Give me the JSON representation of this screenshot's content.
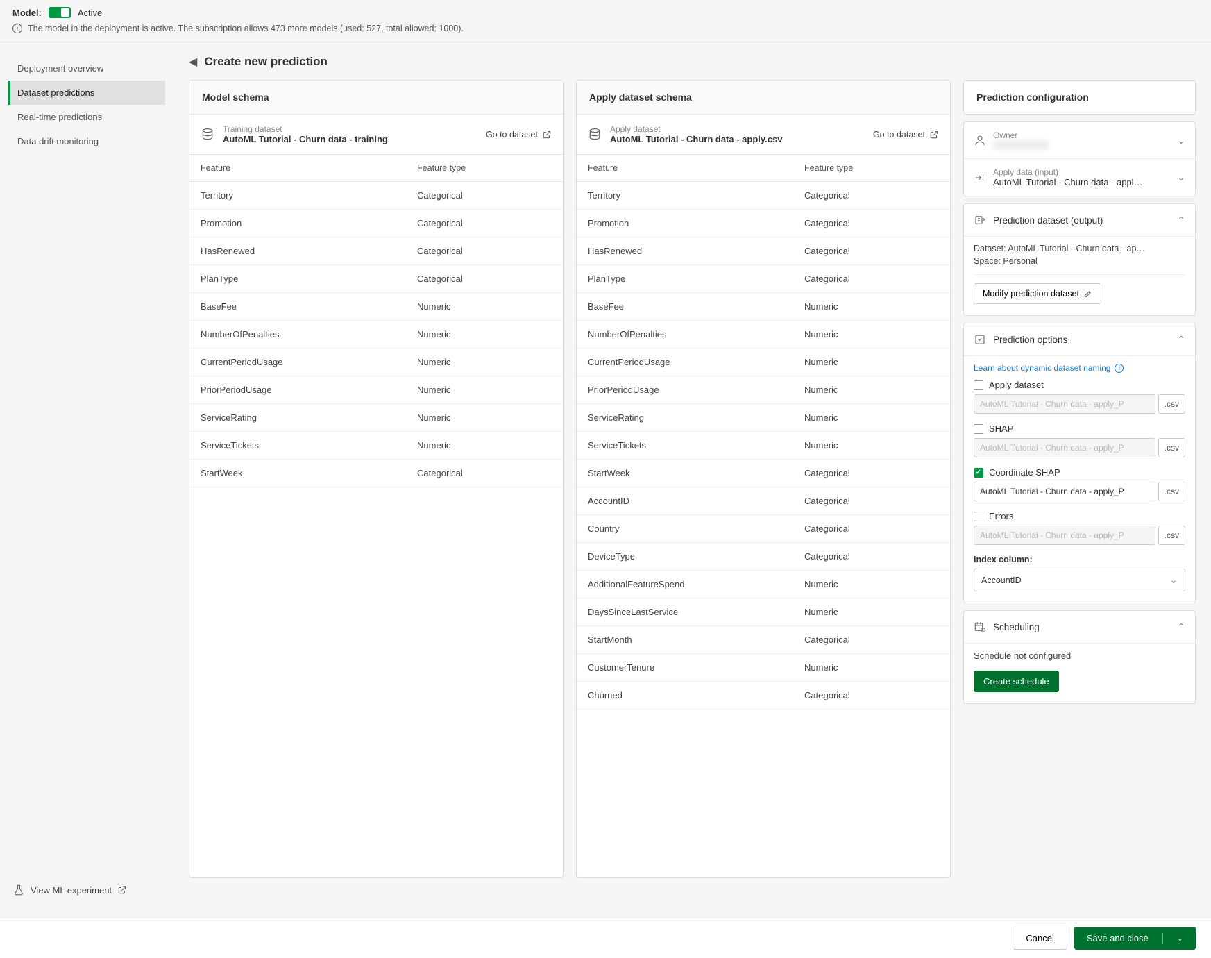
{
  "topbar": {
    "model_label": "Model:",
    "status": "Active",
    "info_text": "The model in the deployment is active. The subscription allows 473 more models (used: 527, total allowed: 1000)."
  },
  "sidebar": {
    "items": [
      {
        "label": "Deployment overview"
      },
      {
        "label": "Dataset predictions"
      },
      {
        "label": "Real-time predictions"
      },
      {
        "label": "Data drift monitoring"
      }
    ],
    "footer": "View ML experiment"
  },
  "page": {
    "title": "Create new prediction"
  },
  "model_schema": {
    "title": "Model schema",
    "dataset_label": "Training dataset",
    "dataset_name": "AutoML Tutorial - Churn data - training",
    "goto": "Go to dataset",
    "headers": {
      "feature": "Feature",
      "type": "Feature type"
    },
    "rows": [
      {
        "feature": "Territory",
        "type": "Categorical"
      },
      {
        "feature": "Promotion",
        "type": "Categorical"
      },
      {
        "feature": "HasRenewed",
        "type": "Categorical"
      },
      {
        "feature": "PlanType",
        "type": "Categorical"
      },
      {
        "feature": "BaseFee",
        "type": "Numeric"
      },
      {
        "feature": "NumberOfPenalties",
        "type": "Numeric"
      },
      {
        "feature": "CurrentPeriodUsage",
        "type": "Numeric"
      },
      {
        "feature": "PriorPeriodUsage",
        "type": "Numeric"
      },
      {
        "feature": "ServiceRating",
        "type": "Numeric"
      },
      {
        "feature": "ServiceTickets",
        "type": "Numeric"
      },
      {
        "feature": "StartWeek",
        "type": "Categorical"
      }
    ]
  },
  "apply_schema": {
    "title": "Apply dataset schema",
    "dataset_label": "Apply dataset",
    "dataset_name": "AutoML Tutorial - Churn data - apply.csv",
    "goto": "Go to dataset",
    "headers": {
      "feature": "Feature",
      "type": "Feature type"
    },
    "rows": [
      {
        "feature": "Territory",
        "type": "Categorical"
      },
      {
        "feature": "Promotion",
        "type": "Categorical"
      },
      {
        "feature": "HasRenewed",
        "type": "Categorical"
      },
      {
        "feature": "PlanType",
        "type": "Categorical"
      },
      {
        "feature": "BaseFee",
        "type": "Numeric"
      },
      {
        "feature": "NumberOfPenalties",
        "type": "Numeric"
      },
      {
        "feature": "CurrentPeriodUsage",
        "type": "Numeric"
      },
      {
        "feature": "PriorPeriodUsage",
        "type": "Numeric"
      },
      {
        "feature": "ServiceRating",
        "type": "Numeric"
      },
      {
        "feature": "ServiceTickets",
        "type": "Numeric"
      },
      {
        "feature": "StartWeek",
        "type": "Categorical"
      },
      {
        "feature": "AccountID",
        "type": "Categorical"
      },
      {
        "feature": "Country",
        "type": "Categorical"
      },
      {
        "feature": "DeviceType",
        "type": "Categorical"
      },
      {
        "feature": "AdditionalFeatureSpend",
        "type": "Numeric"
      },
      {
        "feature": "DaysSinceLastService",
        "type": "Numeric"
      },
      {
        "feature": "StartMonth",
        "type": "Categorical"
      },
      {
        "feature": "CustomerTenure",
        "type": "Numeric"
      },
      {
        "feature": "Churned",
        "type": "Categorical"
      }
    ]
  },
  "config": {
    "title": "Prediction configuration",
    "owner": {
      "label": "Owner"
    },
    "apply_data": {
      "label": "Apply data (input)",
      "value": "AutoML Tutorial - Churn data - appl…"
    },
    "prediction_dataset": {
      "title": "Prediction dataset (output)",
      "dataset_prefix": "Dataset: ",
      "dataset": "AutoML Tutorial - Churn data - ap…",
      "space_prefix": "Space: ",
      "space": "Personal",
      "modify_label": "Modify prediction dataset"
    },
    "options": {
      "title": "Prediction options",
      "learn_link": "Learn about dynamic dataset naming",
      "apply_dataset": {
        "label": "Apply dataset",
        "value": "AutoML Tutorial - Churn data - apply_P",
        "ext": ".csv"
      },
      "shap": {
        "label": "SHAP",
        "value": "AutoML Tutorial - Churn data - apply_P",
        "ext": ".csv"
      },
      "coord_shap": {
        "label": "Coordinate SHAP",
        "value": "AutoML Tutorial - Churn data - apply_P",
        "ext": ".csv"
      },
      "errors": {
        "label": "Errors",
        "value": "AutoML Tutorial - Churn data - apply_P",
        "ext": ".csv"
      },
      "index_label": "Index column:",
      "index_value": "AccountID"
    },
    "scheduling": {
      "title": "Scheduling",
      "status": "Schedule not configured",
      "button": "Create schedule"
    }
  },
  "footer": {
    "cancel": "Cancel",
    "save": "Save and close"
  }
}
